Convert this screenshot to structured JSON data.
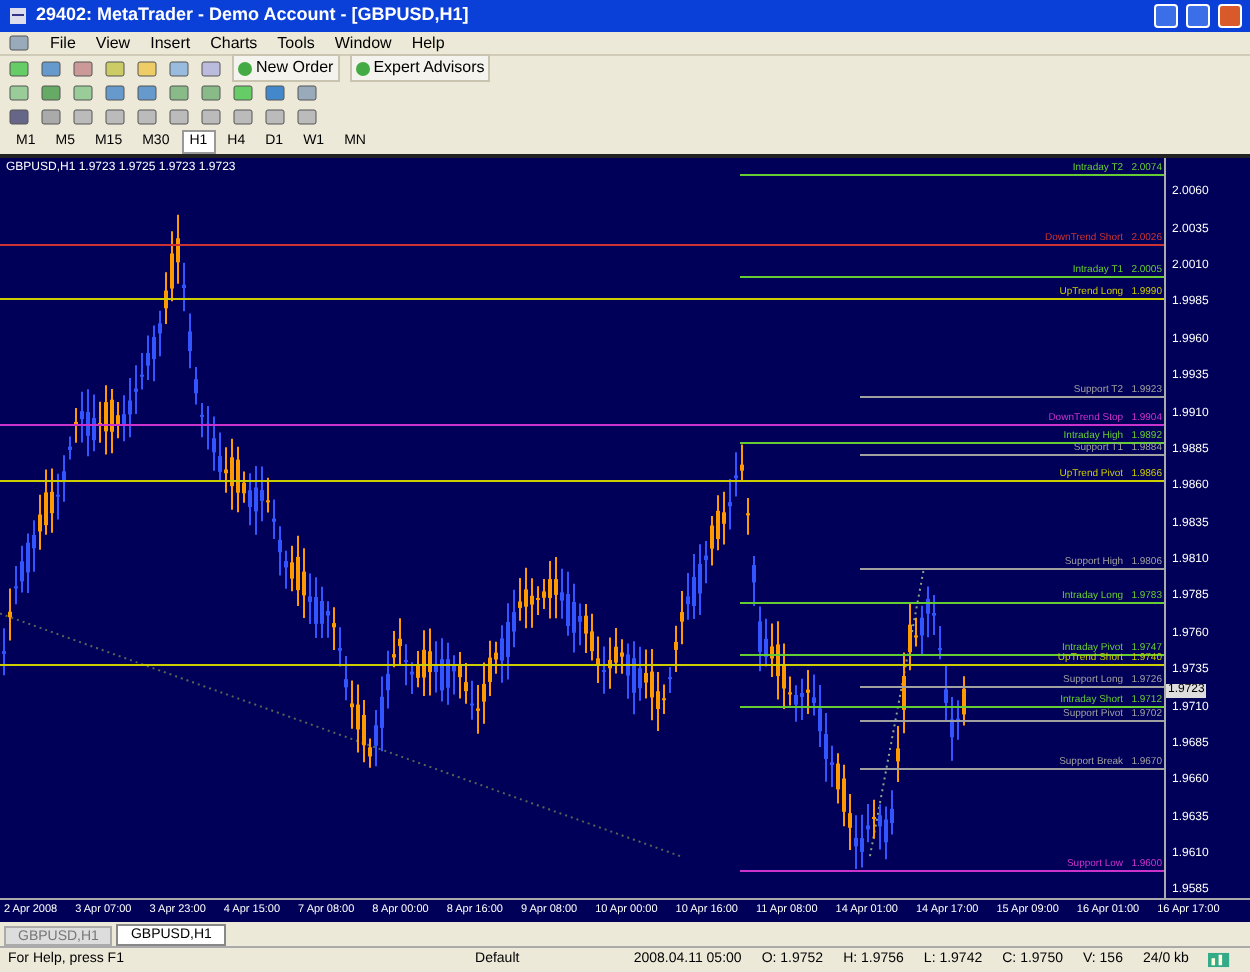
{
  "window": {
    "title": "29402: MetaTrader - Demo Account - [GBPUSD,H1]"
  },
  "menu": [
    "File",
    "View",
    "Insert",
    "Charts",
    "Tools",
    "Window",
    "Help"
  ],
  "toolbar": {
    "buttons": [
      "New Order",
      "Expert Advisors"
    ]
  },
  "timeframes": [
    {
      "label": "M1",
      "selected": false
    },
    {
      "label": "M5",
      "selected": false
    },
    {
      "label": "M15",
      "selected": false
    },
    {
      "label": "M30",
      "selected": false
    },
    {
      "label": "H1",
      "selected": true
    },
    {
      "label": "H4",
      "selected": false
    },
    {
      "label": "D1",
      "selected": false
    },
    {
      "label": "W1",
      "selected": false
    },
    {
      "label": "MN",
      "selected": false
    }
  ],
  "chart": {
    "header": "GBPUSD,H1  1.9723 1.9725 1.9723 1.9723",
    "price_ticks": [
      "2.0060",
      "2.0035",
      "2.0010",
      "1.9985",
      "1.9960",
      "1.9935",
      "1.9910",
      "1.9885",
      "1.9860",
      "1.9835",
      "1.9810",
      "1.9785",
      "1.9760",
      "1.9735",
      "1.9710",
      "1.9685",
      "1.9660",
      "1.9635",
      "1.9610",
      "1.9585"
    ],
    "current_price": "1.9723",
    "time_ticks": [
      "2 Apr 2008",
      "3 Apr 07:00",
      "3 Apr 23:00",
      "4 Apr 15:00",
      "7 Apr 08:00",
      "8 Apr 00:00",
      "8 Apr 16:00",
      "9 Apr 08:00",
      "10 Apr 00:00",
      "10 Apr 16:00",
      "11 Apr 08:00",
      "14 Apr 01:00",
      "14 Apr 17:00",
      "15 Apr 09:00",
      "16 Apr 01:00",
      "16 Apr 17:00"
    ],
    "levels": [
      {
        "name": "Intraday T2",
        "value": "2.0074",
        "color": "#66cc33",
        "kind": "day"
      },
      {
        "name": "DownTrend Short",
        "value": "2.0026",
        "color": "#cc3333",
        "kind": "full"
      },
      {
        "name": "Intraday T1",
        "value": "2.0005",
        "color": "#66cc33",
        "kind": "day"
      },
      {
        "name": "UpTrend Long",
        "value": "1.9990",
        "color": "#cccc00",
        "kind": "full"
      },
      {
        "name": "Support T2",
        "value": "1.9923",
        "color": "#a0a0a0",
        "kind": "short"
      },
      {
        "name": "DownTrend Stop",
        "value": "1.9904",
        "color": "#cc33cc",
        "kind": "full"
      },
      {
        "name": "Intraday High",
        "value": "1.9892",
        "color": "#66cc33",
        "kind": "day"
      },
      {
        "name": "Support T1",
        "value": "1.9884",
        "color": "#a0a0a0",
        "kind": "short"
      },
      {
        "name": "UpTrend Pivot",
        "value": "1.9866",
        "color": "#cccc00",
        "kind": "full"
      },
      {
        "name": "Support High",
        "value": "1.9806",
        "color": "#a0a0a0",
        "kind": "short"
      },
      {
        "name": "Intraday Long",
        "value": "1.9783",
        "color": "#66cc33",
        "kind": "day"
      },
      {
        "name": "Intraday Pivot",
        "value": "1.9747",
        "color": "#66cc33",
        "kind": "day"
      },
      {
        "name": "UpTrend Short",
        "value": "1.9740",
        "color": "#cccc00",
        "kind": "full"
      },
      {
        "name": "Support Long",
        "value": "1.9726",
        "color": "#a0a0a0",
        "kind": "short"
      },
      {
        "name": "Intraday Short",
        "value": "1.9712",
        "color": "#66cc33",
        "kind": "day"
      },
      {
        "name": "Support Pivot",
        "value": "1.9702",
        "color": "#a0a0a0",
        "kind": "short"
      },
      {
        "name": "Support Break",
        "value": "1.9670",
        "color": "#a0a0a0",
        "kind": "short"
      },
      {
        "name": "Support Low",
        "value": "1.9600",
        "color": "#cc33cc",
        "kind": "day"
      }
    ]
  },
  "chart_tabs": [
    {
      "label": "GBPUSD,H1",
      "selected": false
    },
    {
      "label": "GBPUSD,H1",
      "selected": true
    }
  ],
  "status_bar": [
    "For Help, press F1",
    "Default",
    "2008.04.11 05:00",
    "O: 1.9752",
    "H: 1.9756",
    "L: 1.9742",
    "C: 1.9750",
    "V: 156",
    "24/0 kb"
  ]
}
